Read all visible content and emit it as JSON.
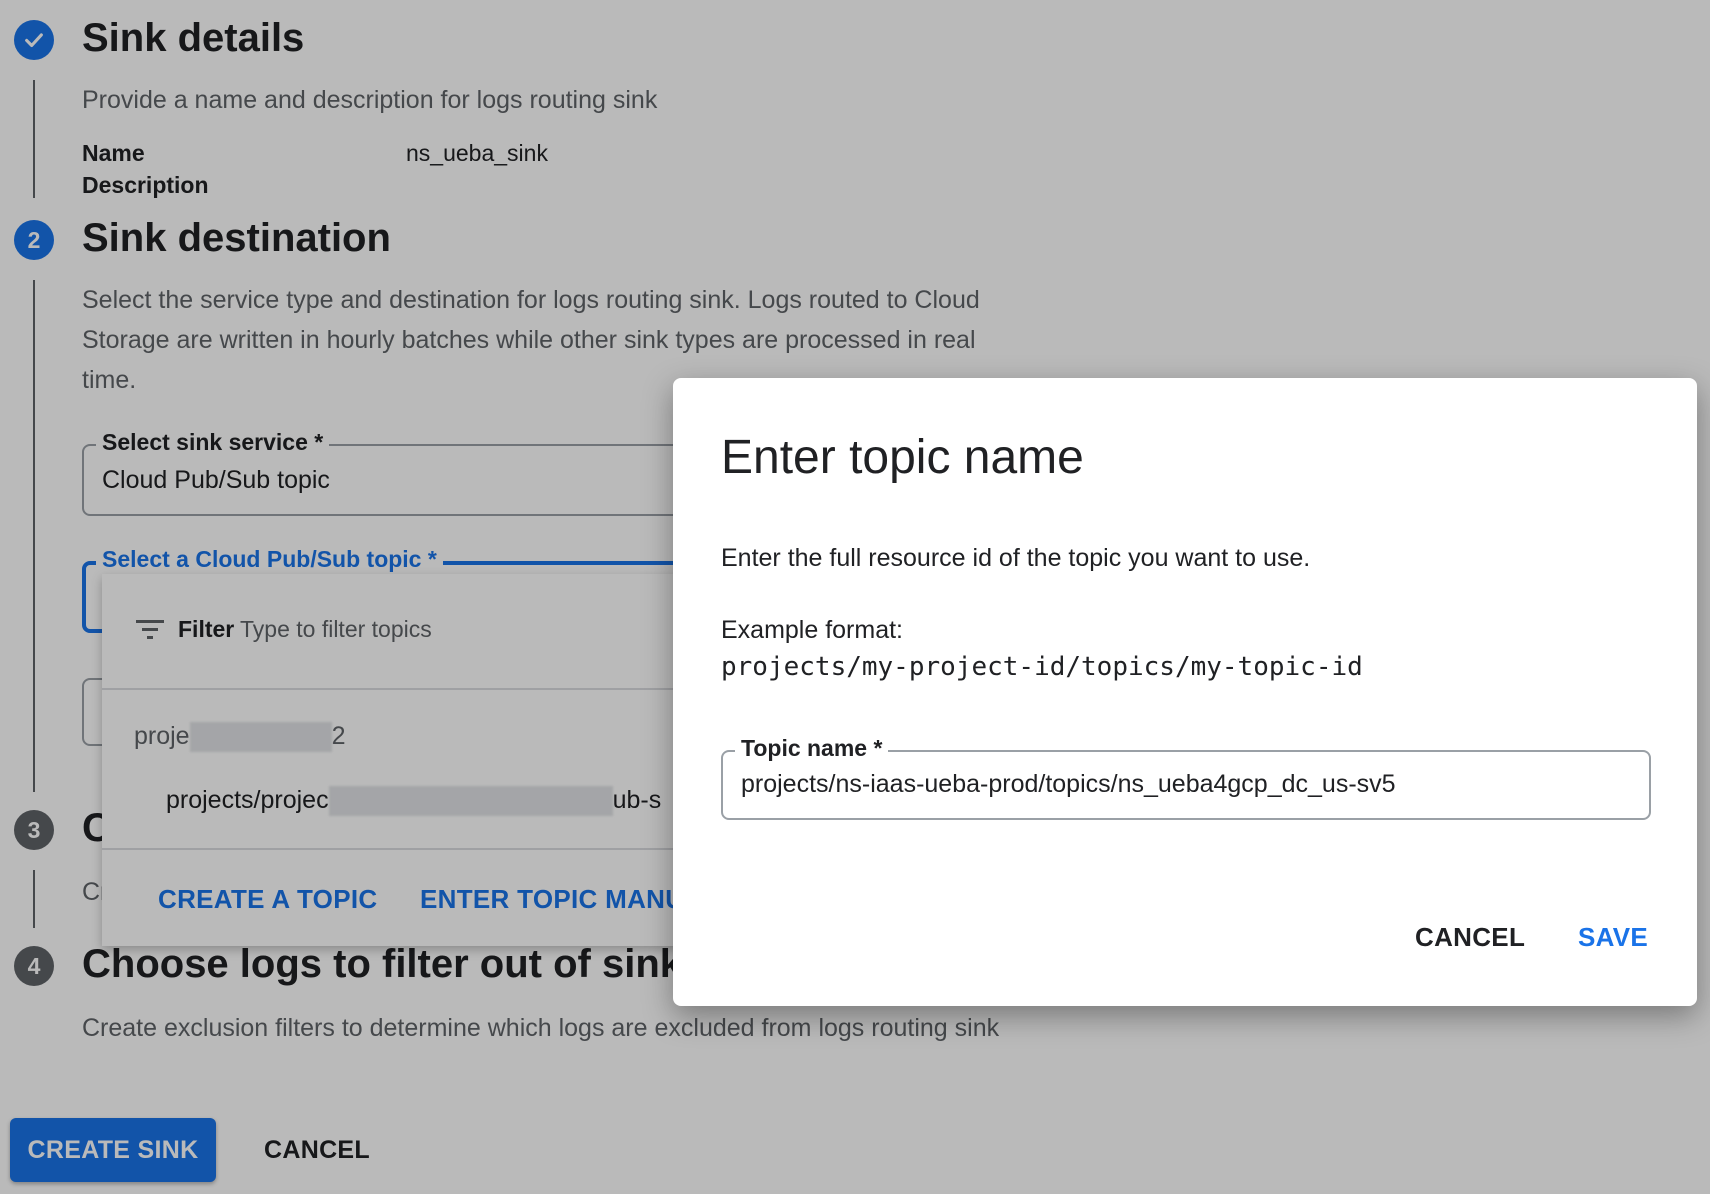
{
  "steps": [
    {
      "number": "✓",
      "title": "Sink details",
      "description": "Provide a name and description for logs routing sink",
      "fields": [
        {
          "label": "Name",
          "value": "ns_ueba_sink"
        },
        {
          "label": "Description",
          "value": ""
        }
      ]
    },
    {
      "number": "2",
      "title": "Sink destination",
      "description": "Select the service type and destination for logs routing sink. Logs routed to Cloud Storage are written in hourly batches while other sink types are processed in real time.",
      "service_label": "Select sink service *",
      "service_value": "Cloud Pub/Sub topic",
      "topic_label": "Select a Cloud Pub/Sub topic *"
    },
    {
      "number": "3",
      "title": "C",
      "description": "Cr"
    },
    {
      "number": "4",
      "title": "Choose logs to filter out of sink (o",
      "description": "Create exclusion filters to determine which logs are excluded from logs routing sink"
    }
  ],
  "topic_menu": {
    "filter_label": "Filter",
    "filter_placeholder": "Type to filter topics",
    "group_prefix": "proje",
    "group_suffix": "2",
    "item_prefix": "projects/projec",
    "item_suffix": "ub-s",
    "create_topic": "CREATE A TOPIC",
    "enter_topic": "ENTER TOPIC MANUA"
  },
  "footer": {
    "create_sink": "CREATE SINK",
    "cancel": "CANCEL"
  },
  "dialog": {
    "title": "Enter topic name",
    "instruction": "Enter the full resource id of the topic you want to use.",
    "example_label": "Example format:",
    "example_value": "projects/my-project-id/topics/my-topic-id",
    "topic_label": "Topic name *",
    "topic_value": "projects/ns-iaas-ueba-prod/topics/ns_ueba4gcp_dc_us-sv5",
    "cancel": "CANCEL",
    "save": "SAVE"
  },
  "colors": {
    "accent": "#1a73e8",
    "muted_step": "#5f6368"
  }
}
